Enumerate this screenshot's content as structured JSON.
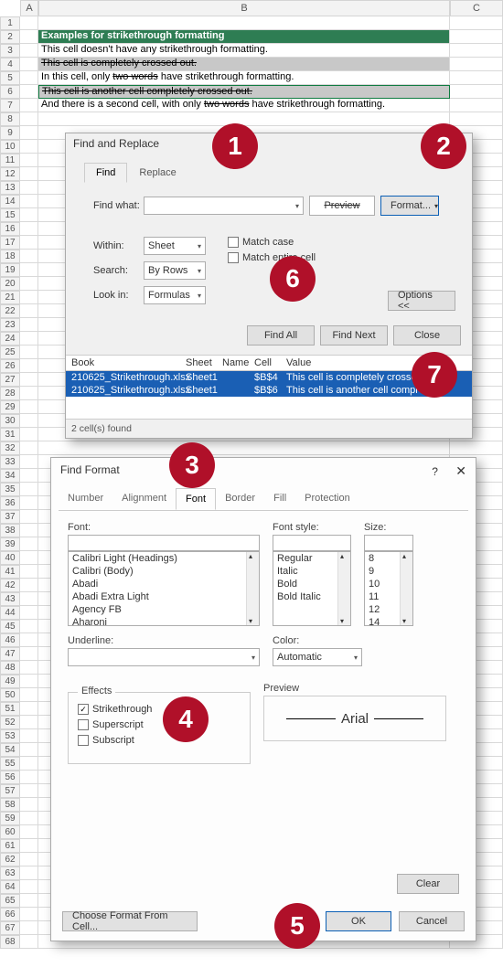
{
  "col_headers": {
    "A": "A",
    "B": "B",
    "C": "C"
  },
  "sheet": {
    "row2": "Examples for strikethrough formatting",
    "row3": "This cell doesn't have any strikethrough formatting.",
    "row4": "This cell is completely crossed out.",
    "row5_pre": "In this cell, only ",
    "row5_strike": "two words",
    "row5_post": " have strikethrough formatting.",
    "row6": "This cell is another cell completely crossed out.",
    "row7_pre": "And there is a second cell, with only ",
    "row7_strike": "two words",
    "row7_post": " have strikethrough formatting."
  },
  "find": {
    "title": "Find and Replace",
    "tab_find": "Find",
    "tab_replace": "Replace",
    "find_what": "Find what:",
    "preview": "Preview",
    "format": "Format...",
    "within": "Within:",
    "within_v": "Sheet",
    "search": "Search:",
    "search_v": "By Rows",
    "lookin": "Look in:",
    "lookin_v": "Formulas",
    "match_case": "Match case",
    "match_entire": "Match entire cell",
    "options": "Options <<",
    "find_all": "Find All",
    "find_next": "Find Next",
    "close": "Close",
    "col_book": "Book",
    "col_sheet": "Sheet",
    "col_name": "Name",
    "col_cell": "Cell",
    "col_value": "Value",
    "r1_book": "210625_Strikethrough.xlsx",
    "r1_sheet": "Sheet1",
    "r1_cell": "$B$4",
    "r1_val": "This cell is completely crossed",
    "r2_book": "210625_Strikethrough.xlsx",
    "r2_sheet": "Sheet1",
    "r2_cell": "$B$6",
    "r2_val": "This cell is another cell compl",
    "status": "2 cell(s) found"
  },
  "fmt": {
    "title": "Find Format",
    "help": "?",
    "tab_number": "Number",
    "tab_align": "Alignment",
    "tab_font": "Font",
    "tab_border": "Border",
    "tab_fill": "Fill",
    "tab_prot": "Protection",
    "font": "Font:",
    "font_style": "Font style:",
    "size": "Size:",
    "fonts": [
      "Calibri Light (Headings)",
      "Calibri (Body)",
      "Abadi",
      "Abadi Extra Light",
      "Agency FB",
      "Aharoni"
    ],
    "styles": [
      "Regular",
      "Italic",
      "Bold",
      "Bold Italic"
    ],
    "sizes": [
      "8",
      "9",
      "10",
      "11",
      "12",
      "14"
    ],
    "underline": "Underline:",
    "color": "Color:",
    "color_v": "Automatic",
    "effects": "Effects",
    "strikethrough": "Strikethrough",
    "superscript": "Superscript",
    "subscript": "Subscript",
    "preview": "Preview",
    "preview_text": "Arial",
    "clear": "Clear",
    "choose": "Choose Format From Cell...",
    "ok": "OK",
    "cancel": "Cancel"
  },
  "callouts": {
    "c1": "1",
    "c2": "2",
    "c3": "3",
    "c4": "4",
    "c5": "5",
    "c6": "6",
    "c7": "7"
  }
}
